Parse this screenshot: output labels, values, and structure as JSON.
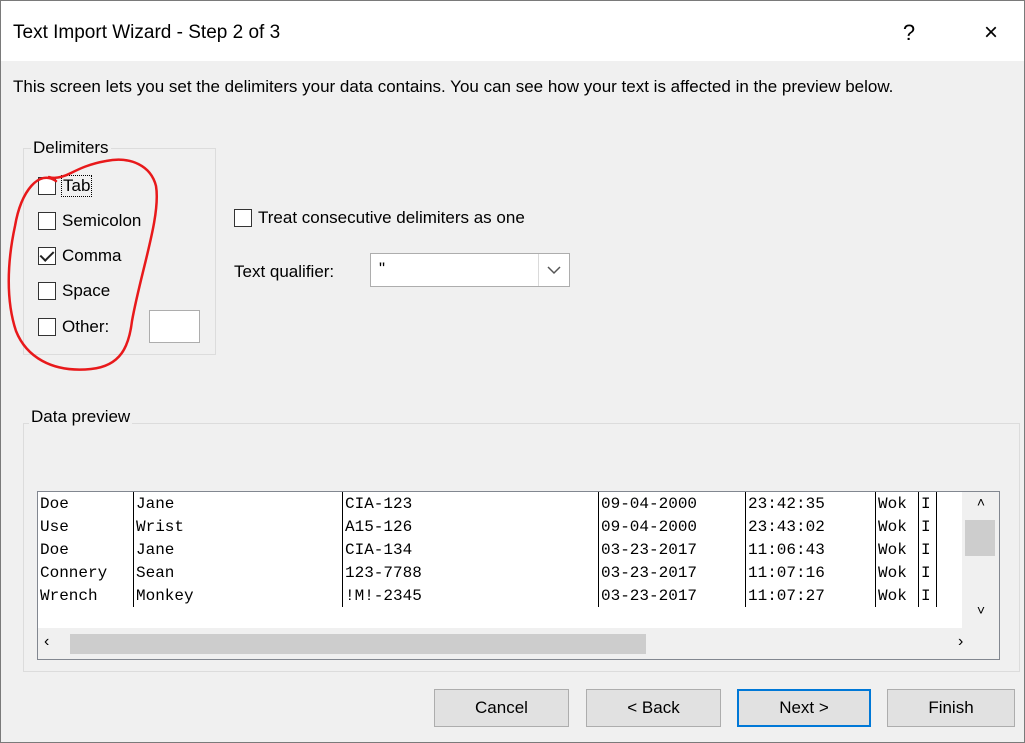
{
  "dialog": {
    "title": "Text Import Wizard - Step 2 of 3",
    "help_label": "?",
    "close_label": "×",
    "description": "This screen lets you set the delimiters your data contains.  You can see how your text is affected in the preview below."
  },
  "delimiters": {
    "group_label": "Delimiters",
    "tab": {
      "label": "Tab",
      "checked": false
    },
    "semicolon": {
      "label": "Semicolon",
      "checked": false
    },
    "comma": {
      "label": "Comma",
      "checked": true
    },
    "space": {
      "label": "Space",
      "checked": false
    },
    "other": {
      "label": "Other:",
      "checked": false,
      "value": ""
    }
  },
  "options": {
    "consecutive_label": "Treat consecutive delimiters as one",
    "consecutive_checked": false,
    "qualifier_label": "Text qualifier:",
    "qualifier_value": "\""
  },
  "preview": {
    "group_label": "Data preview",
    "rows": [
      [
        "Doe",
        "Jane",
        "CIA-123",
        "09-04-2000",
        "23:42:35",
        "Wok",
        "I"
      ],
      [
        "Use",
        "Wrist",
        "A15-126",
        "09-04-2000",
        "23:43:02",
        "Wok",
        "I"
      ],
      [
        "Doe",
        "Jane",
        "CIA-134",
        "03-23-2017",
        "11:06:43",
        "Wok",
        "I"
      ],
      [
        "Connery",
        "Sean",
        "123-7788",
        "03-23-2017",
        "11:07:16",
        "Wok",
        "I"
      ],
      [
        "Wrench",
        "Monkey",
        "!M!-2345",
        "03-23-2017",
        "11:07:27",
        "Wok",
        "I"
      ]
    ]
  },
  "buttons": {
    "cancel": "Cancel",
    "back": "< Back",
    "next": "Next >",
    "finish": "Finish"
  },
  "colors": {
    "annotation": "#e8191b",
    "default_button_border": "#0078d7",
    "dialog_background": "#f0f0f0"
  }
}
